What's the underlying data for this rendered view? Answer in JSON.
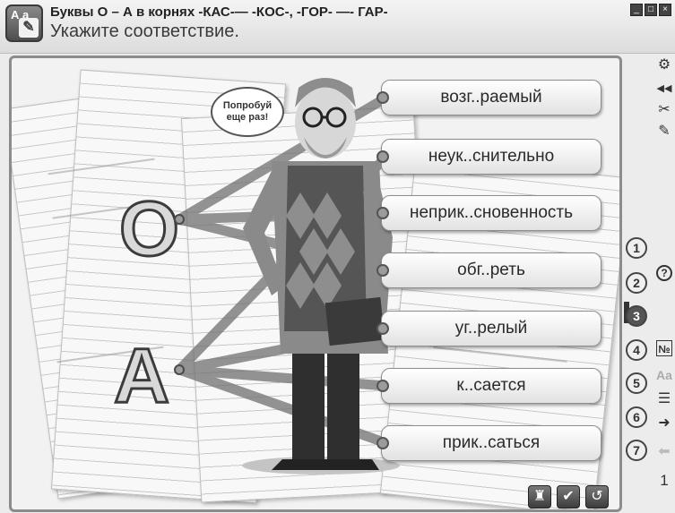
{
  "window": {
    "title": "Буквы О – А в корнях  -КАС-— -КОС-, -ГОР- —- ГАР-",
    "subtitle": "Укажите соответствие.",
    "app_icon_text": "А а",
    "app_icon_pen": "✎",
    "controls": {
      "minimize": "_",
      "maximize": "□",
      "close": "×"
    }
  },
  "speech_bubble": "Попробуй еще раз!",
  "letters": [
    "О",
    "А"
  ],
  "words": [
    "возг..раемый",
    "неук..снительно",
    "неприк..сновенность",
    "обг..реть",
    "уг..релый",
    "к..сается",
    "прик..саться"
  ],
  "bottom_controls": {
    "hint": "♜",
    "check": "✔",
    "reset": "↺"
  },
  "sidebar": {
    "icons": [
      "settings-icon",
      "sound-icon",
      "tools-icon",
      "pencil-icon"
    ],
    "glyphs": {
      "settings": "⚙",
      "sound": "◀◀",
      "tools": "✂",
      "pencil": "✎",
      "help": "?",
      "numbering": "№",
      "font": "Aa",
      "list": "☰",
      "next": "➜",
      "prev": "⬅"
    },
    "tasks": [
      "1",
      "2",
      "3",
      "4",
      "5",
      "6",
      "7"
    ],
    "active_task": "3",
    "page": "1"
  }
}
